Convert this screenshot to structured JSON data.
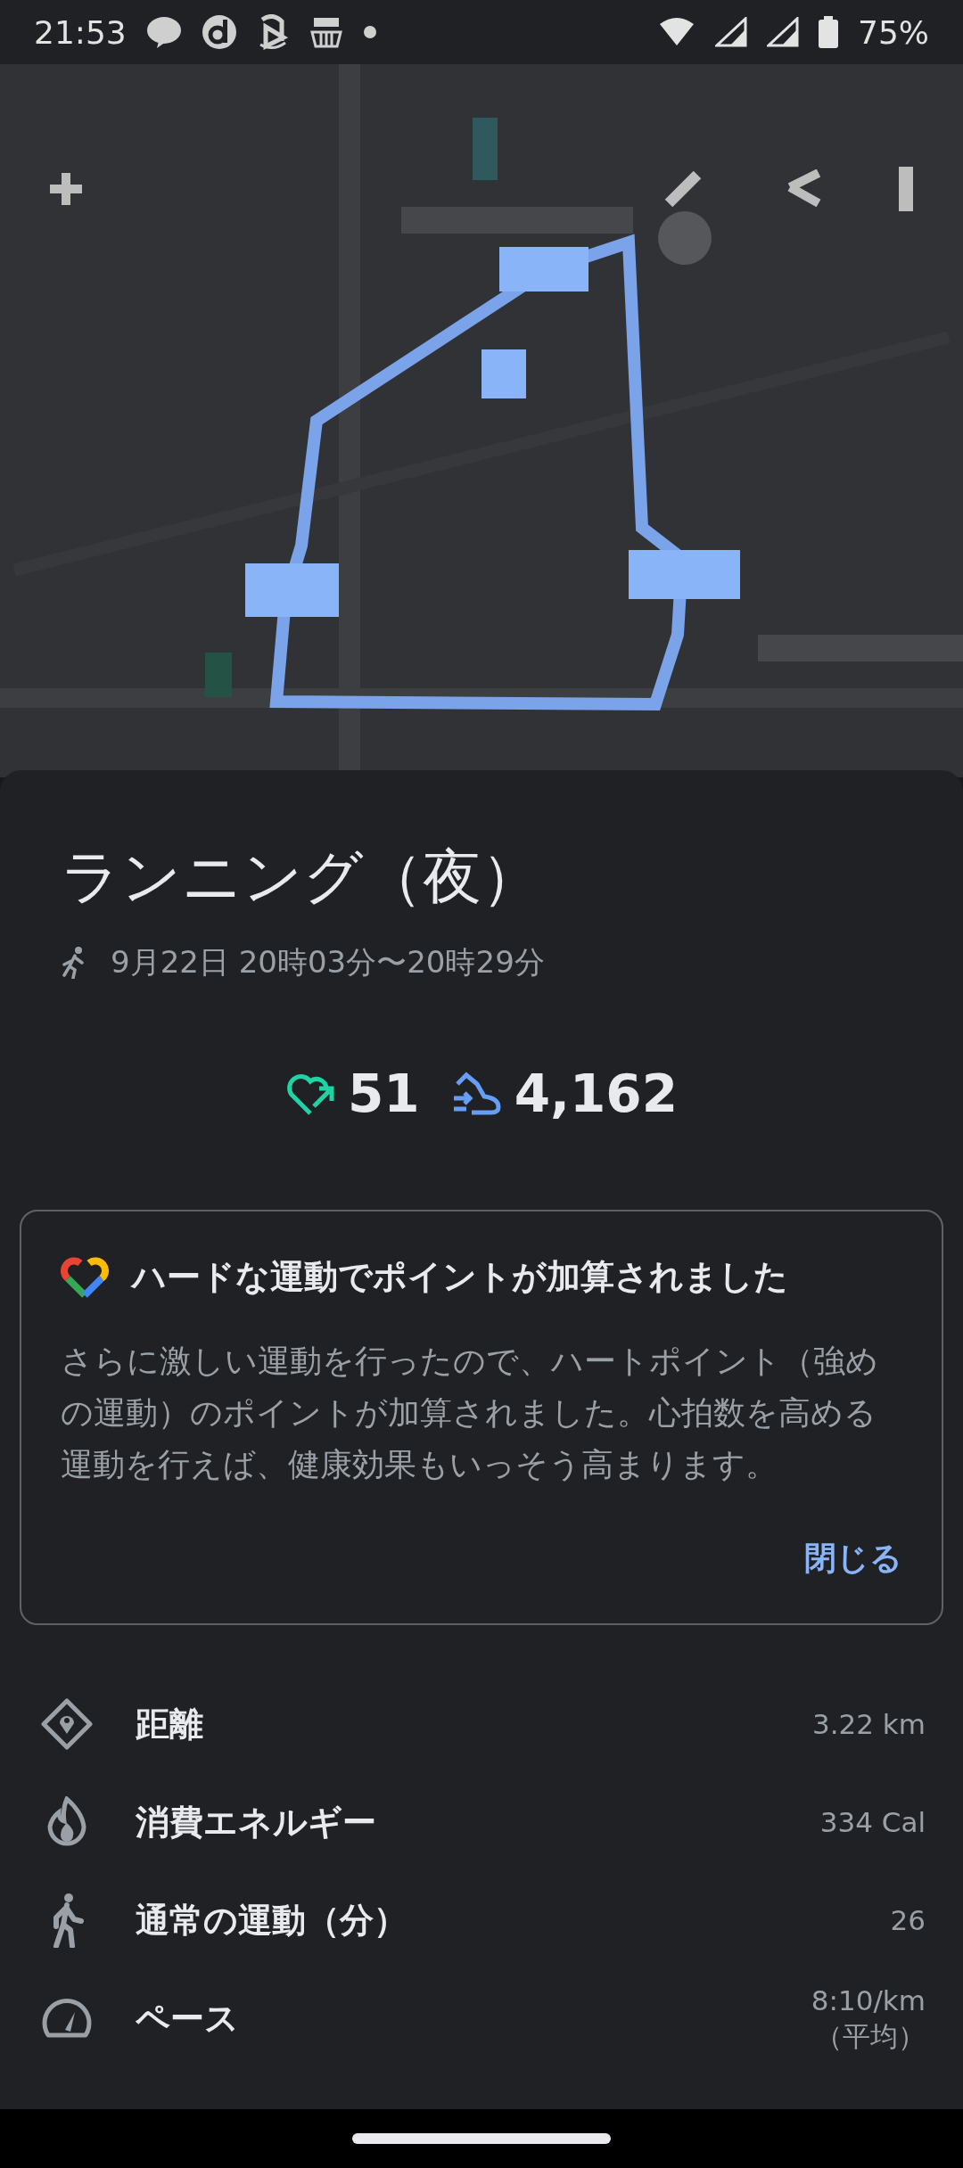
{
  "status_bar": {
    "time": "21:53",
    "battery": "75%"
  },
  "activity": {
    "title": "ランニング（夜）",
    "datetime": "9月22日 20時03分〜20時29分"
  },
  "summary": [
    {
      "kind": "heart_points",
      "value": "51"
    },
    {
      "kind": "steps",
      "value": "4,162"
    }
  ],
  "notice": {
    "title": "ハードな運動でポイントが加算されました",
    "body": "さらに激しい運動を行ったので、ハートポイント（強めの運動）のポイントが加算されました。心拍数を高める運動を行えば、健康効果もいっそう高まります。",
    "action": "閉じる"
  },
  "metrics": [
    {
      "kind": "distance",
      "label": "距離",
      "value": "3.22 km"
    },
    {
      "kind": "energy",
      "label": "消費エネルギー",
      "value": "334 Cal"
    },
    {
      "kind": "move_minutes",
      "label": "通常の運動（分）",
      "value": "26"
    },
    {
      "kind": "pace",
      "label": "ペース",
      "value": "8:10/km",
      "note": "（平均）"
    }
  ]
}
